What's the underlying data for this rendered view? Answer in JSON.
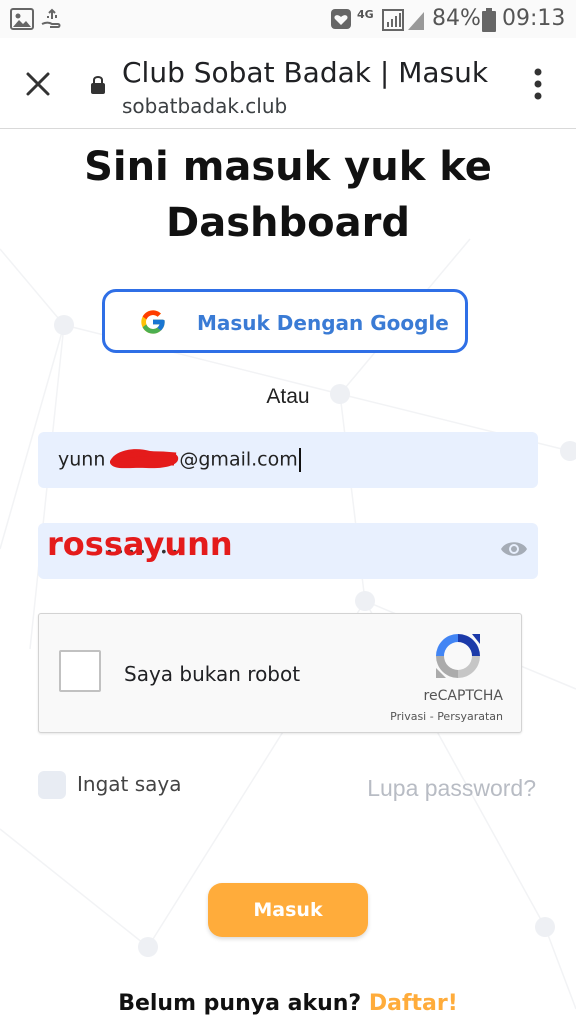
{
  "status_bar": {
    "network": "4G",
    "battery": "84%",
    "time": "09:13",
    "icons": [
      "image-icon",
      "usb-hand-icon",
      "notification-icon",
      "signal-icon",
      "battery-icon"
    ]
  },
  "browser": {
    "title": "Club Sobat Badak | Masuk",
    "url": "sobatbadak.club",
    "icons": [
      "close-icon",
      "lock-icon",
      "more-vert-icon"
    ]
  },
  "page": {
    "heading_line1": "Sini masuk yuk ke",
    "heading_line2": "Dashboard",
    "google_button": "Masuk Dengan Google",
    "divider": "Atau",
    "email_value_prefix": "yunn",
    "email_value_suffix": "@gmail.com",
    "password_dots": "••••••••",
    "password_overlay": "rossayunn",
    "captcha_label": "Saya bukan robot",
    "captcha_brand": "reCAPTCHA",
    "captcha_links": "Privasi - Persyaratan",
    "remember_label": "Ingat saya",
    "forgot_link": "Lupa password?",
    "submit_button": "Masuk",
    "signup_prompt": "Belum punya akun?",
    "signup_link": "Daftar!"
  },
  "colors": {
    "accent_orange": "#ffac3b",
    "google_blue": "#2f6fe6",
    "field_bg": "#e8f0fe",
    "annotation_red": "#e41b1b"
  }
}
